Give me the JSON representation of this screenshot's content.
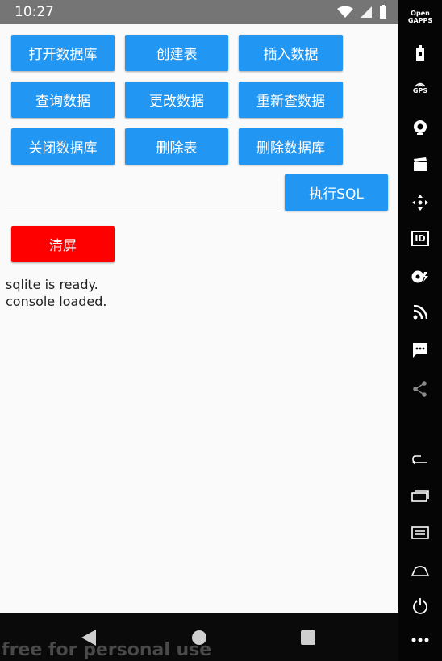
{
  "status_bar": {
    "time": "10:27"
  },
  "buttons": {
    "open_db": "打开数据库",
    "create_table": "创建表",
    "insert_data": "插入数据",
    "query_data": "查询数据",
    "update_data": "更改数据",
    "requery_data": "重新查数据",
    "close_db": "关闭数据库",
    "drop_table": "删除表",
    "delete_db": "删除数据库",
    "execute_sql": "执行SQL",
    "clear_screen": "清屏"
  },
  "sql_input": {
    "value": "",
    "placeholder": ""
  },
  "console": {
    "lines": [
      "sqlite is ready.",
      "console loaded."
    ]
  },
  "side_panel": {
    "brand_line1": "Open",
    "brand_line2": "GAPPS",
    "gps_label": "GPS",
    "id_label": "ID",
    "icons": [
      "battery-icon",
      "gps-icon",
      "camera-icon",
      "clapperboard-icon",
      "dpad-icon",
      "id-icon",
      "disc-icon",
      "rss-icon",
      "message-icon",
      "share-icon",
      "back-icon",
      "recents-icon",
      "menu-icon",
      "home-icon",
      "power-icon",
      "more-icon"
    ]
  },
  "watermark": "free for personal use",
  "colors": {
    "primary": "#2196f3",
    "danger": "#ff0000",
    "status_bar": "#757575"
  }
}
